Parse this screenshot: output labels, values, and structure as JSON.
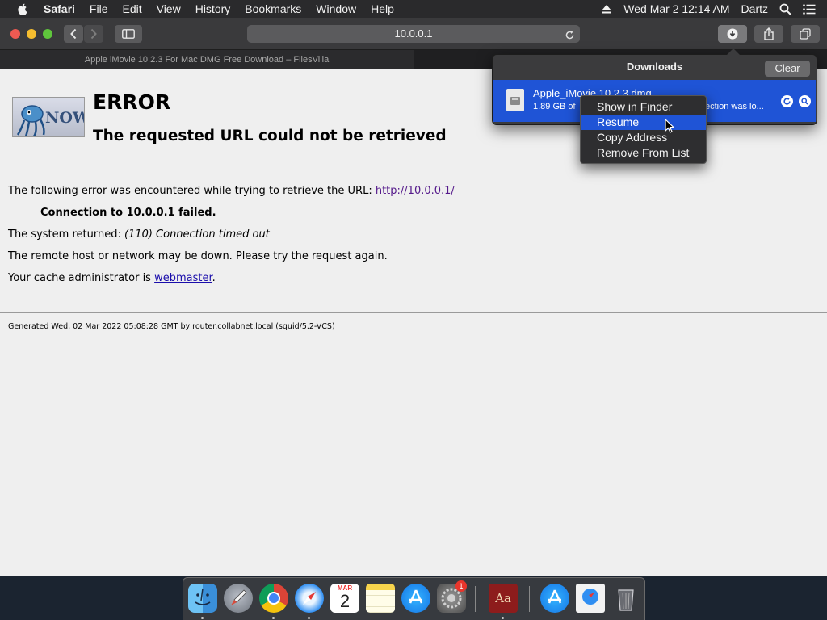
{
  "menubar": {
    "app_name": "Safari",
    "items": [
      "File",
      "Edit",
      "View",
      "History",
      "Bookmarks",
      "Window",
      "Help"
    ],
    "datetime": "Wed Mar 2  12:14 AM",
    "user": "Dartz"
  },
  "toolbar": {
    "url": "10.0.0.1"
  },
  "tab": {
    "title": "Apple iMovie 10.2.3 For Mac DMG Free Download – FilesVilla"
  },
  "page": {
    "logo_text": "NOW",
    "title": "ERROR",
    "subtitle": "The requested URL could not be retrieved",
    "line1_prefix": "The following error was encountered while trying to retrieve the URL: ",
    "line1_link": "http://10.0.0.1/",
    "connection_failed": "Connection to 10.0.0.1 failed.",
    "returned_prefix": "The system returned: ",
    "returned_value": "(110) Connection timed out",
    "network_msg": "The remote host or network may be down. Please try the request again.",
    "admin_prefix": "Your cache administrator is ",
    "admin_link": "webmaster",
    "admin_suffix": ".",
    "footer": "Generated Wed, 02 Mar 2022 05:08:28 GMT by router.collabnet.local (squid/5.2-VCS)"
  },
  "downloads": {
    "title": "Downloads",
    "clear_label": "Clear",
    "file_name": "Apple_iMovie 10.2.3.dmg",
    "status_left": "1.89 GB of",
    "status_right": "ection was lo..."
  },
  "context_menu": {
    "items": [
      "Show in Finder",
      "Resume",
      "Copy Address",
      "Remove From List"
    ],
    "highlighted": "Resume"
  },
  "dock": {
    "calendar_month": "MAR",
    "calendar_day": "2",
    "badge_count": "1",
    "dictionary_label": "Aa",
    "apps": [
      "finder",
      "launchpad",
      "chrome",
      "safari",
      "calendar",
      "notes",
      "app-store",
      "system-preferences",
      "dictionary",
      "app-store-downloads",
      "downloads-stack",
      "trash"
    ]
  },
  "colors": {
    "accent_blue": "#1f54d6",
    "link": "#1a0dab",
    "visited_link": "#551a8b",
    "close": "#ee5a52",
    "minimize": "#f5bd2f",
    "zoom": "#5fc63c"
  }
}
